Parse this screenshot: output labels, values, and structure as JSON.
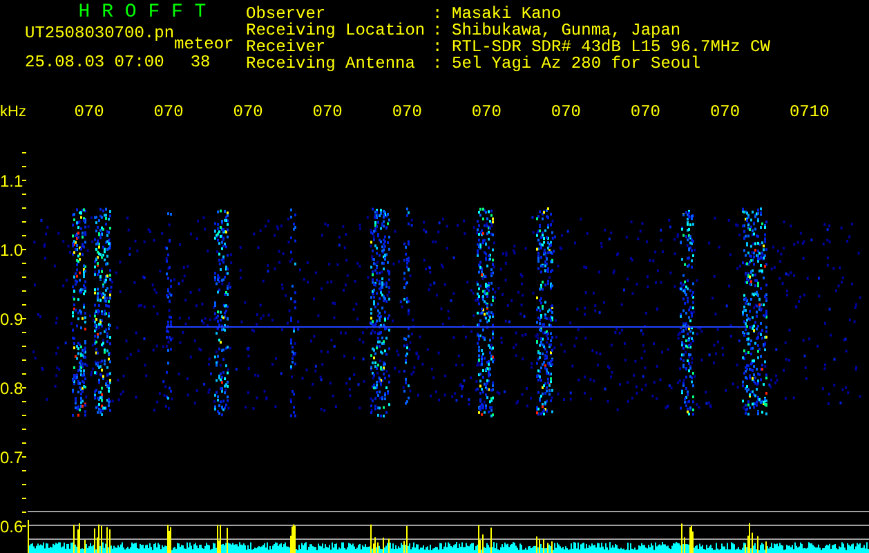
{
  "header": {
    "title": "H R O F F T",
    "filename": "UT2508030700.pn",
    "event_type": "meteor",
    "timestamp": "25.08.03 07:00",
    "count": "38"
  },
  "info": [
    {
      "label": "Observer",
      "separator": ":",
      "value": "Masaki Kano"
    },
    {
      "label": "Receiving Location",
      "separator": ":",
      "value": "Shibukawa, Gunma, Japan"
    },
    {
      "label": "Receiver",
      "separator": ":",
      "value": "RTL-SDR SDR# 43dB L15 96.7MHz CW"
    },
    {
      "label": "Receiving Antenna",
      "separator": ":",
      "value": "5el Yagi Az 280 for Seoul"
    }
  ],
  "plot": {
    "unit": "kHz",
    "time_labels": [
      "070",
      "070",
      "070",
      "070",
      "070",
      "070",
      "070",
      "070",
      "070",
      "0710"
    ],
    "frequency_labels": [
      "1.1",
      "1.0",
      "0.9",
      "0.8",
      "0.7",
      "0.6"
    ]
  }
}
